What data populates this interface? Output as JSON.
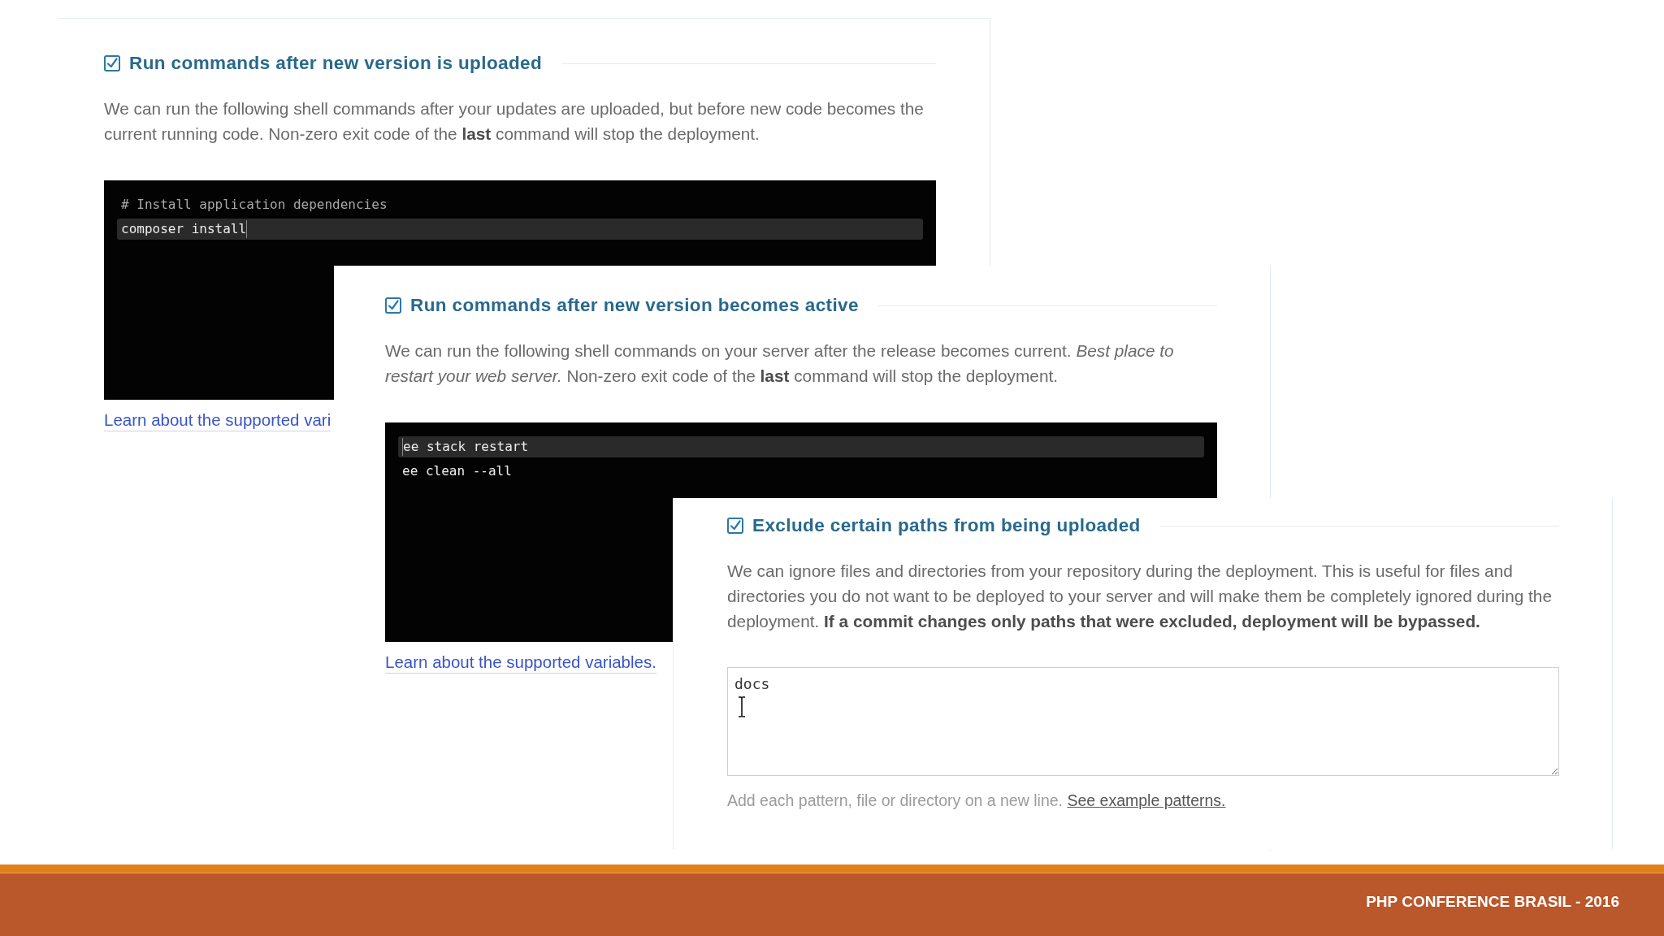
{
  "panels": [
    {
      "kind": "commands",
      "heading": "Run commands after new version is uploaded",
      "checked": true,
      "description": "We can run the following shell commands after your updates are uploaded, but before new code becomes the current running code. Non-zero exit code of the **last** command will stop the deployment.",
      "editor": {
        "lines": [
          {
            "kind": "comment",
            "text": "# Install application dependencies",
            "highlighted": false,
            "caret_before": false,
            "caret_after": false
          },
          {
            "kind": "command",
            "text": "composer install",
            "highlighted": true,
            "caret_before": false,
            "caret_after": true
          }
        ]
      },
      "link": "Learn about the supported vari"
    },
    {
      "kind": "commands",
      "heading": "Run commands after new version becomes active",
      "checked": true,
      "description": "We can run the following shell commands on your server after the release becomes current. *Best place to restart your web server.* Non-zero exit code of the **last** command will stop the deployment.",
      "editor": {
        "lines": [
          {
            "kind": "command",
            "text": "ee stack restart",
            "highlighted": true,
            "caret_before": true,
            "caret_after": false
          },
          {
            "kind": "command",
            "text": "ee clean --all",
            "highlighted": false,
            "caret_before": false,
            "caret_after": false
          }
        ]
      },
      "link": "Learn about the supported variables."
    },
    {
      "kind": "paths",
      "heading": "Exclude certain paths from being uploaded",
      "checked": true,
      "description": "We can ignore files and directories from your repository during the deployment. This is useful for files and directories you do not want to be deployed to your server and will make them be completely ignored during the deployment. **If a commit changes only paths that were excluded, deployment will be bypassed.**",
      "textarea": {
        "value": "docs"
      },
      "hint": {
        "text": "Add each pattern, file or directory on a new line.",
        "link": "See example patterns."
      }
    }
  ],
  "footer": {
    "title": "PHP CONFERENCE BRASIL - 2016"
  }
}
